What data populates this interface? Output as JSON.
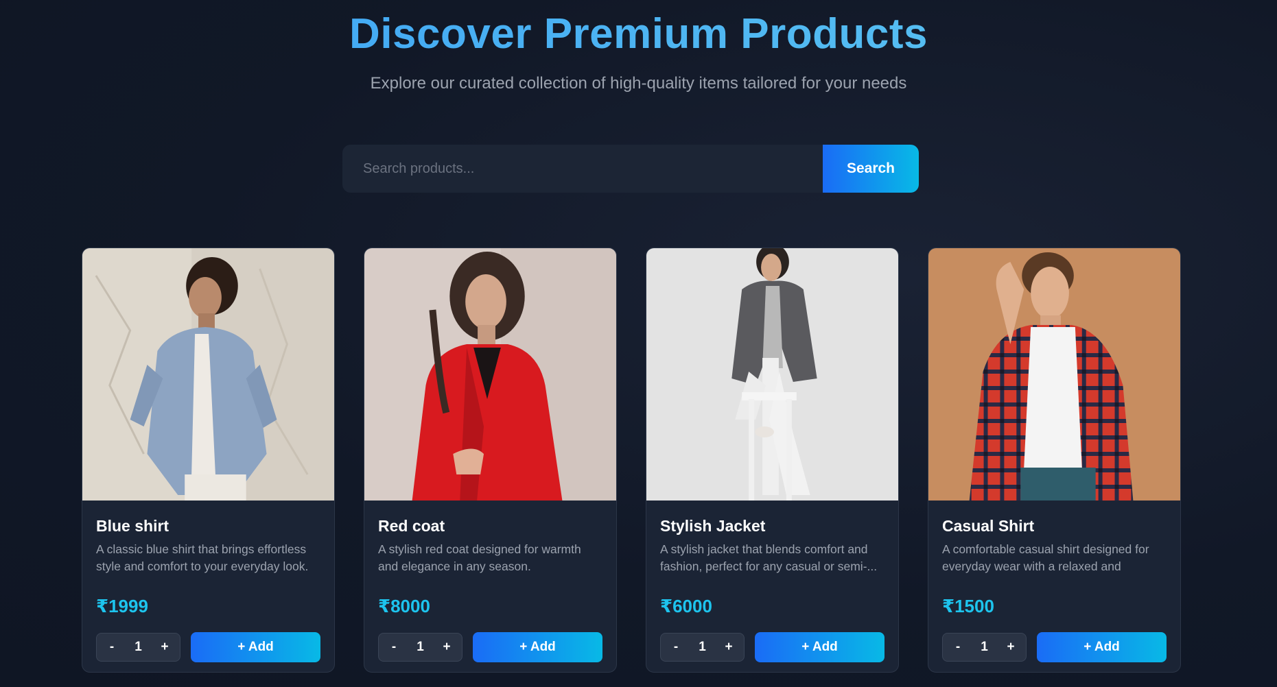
{
  "hero": {
    "title": "Discover Premium Products",
    "subtitle": "Explore our curated collection of high-quality items tailored for your needs"
  },
  "search": {
    "placeholder": "Search products...",
    "button_label": "Search"
  },
  "colors": {
    "background": "#111827",
    "card": "#1b2435",
    "accent_start": "#1a6cf6",
    "accent_end": "#08b9e6",
    "price": "#1dc4ee",
    "title_gradient": "#3aa0f5"
  },
  "products": [
    {
      "title": "Blue shirt",
      "description": "A classic blue shirt that brings effortless style and comfort to your everyday look.",
      "price": "₹1999",
      "quantity": "1",
      "minus_label": "-",
      "plus_label": "+",
      "add_label": "+  Add",
      "image": "man-in-blue-shirt-photo"
    },
    {
      "title": "Red coat",
      "description": "A stylish red coat designed for warmth and elegance in any season.",
      "price": "₹8000",
      "quantity": "1",
      "minus_label": "-",
      "plus_label": "+",
      "add_label": "+  Add",
      "image": "woman-in-red-coat-photo"
    },
    {
      "title": "Stylish Jacket",
      "description": "A stylish jacket that blends comfort and fashion, perfect for any casual or semi-...",
      "price": "₹6000",
      "quantity": "1",
      "minus_label": "-",
      "plus_label": "+",
      "add_label": "+  Add",
      "image": "woman-in-grey-jacket-photo"
    },
    {
      "title": "Casual Shirt",
      "description": "A comfortable casual shirt designed for everyday wear with a relaxed and moder...",
      "price": "₹1500",
      "quantity": "1",
      "minus_label": "-",
      "plus_label": "+",
      "add_label": "+  Add",
      "image": "man-in-plaid-shirt-photo"
    }
  ]
}
